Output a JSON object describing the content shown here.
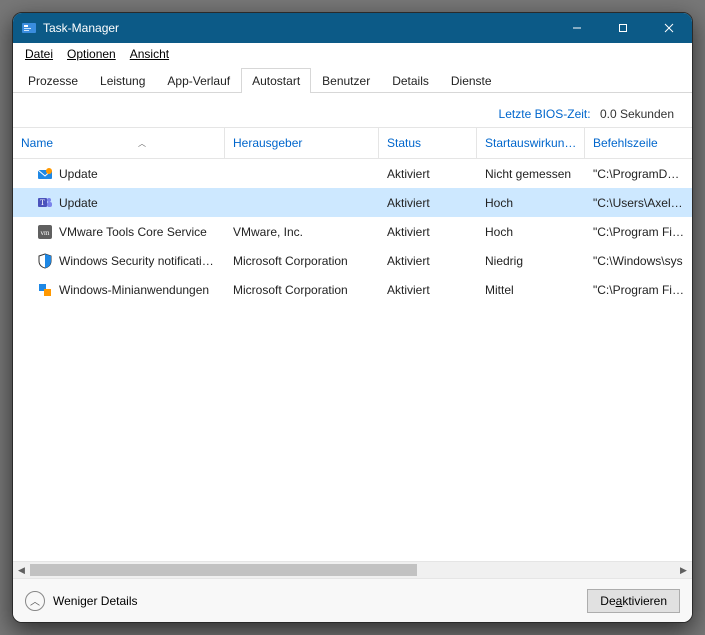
{
  "window": {
    "title": "Task-Manager"
  },
  "menu": {
    "items": [
      "Datei",
      "Optionen",
      "Ansicht"
    ]
  },
  "tabs": {
    "items": [
      "Prozesse",
      "Leistung",
      "App-Verlauf",
      "Autostart",
      "Benutzer",
      "Details",
      "Dienste"
    ],
    "active_index": 3
  },
  "bios": {
    "label": "Letzte BIOS-Zeit:",
    "value": "0.0 Sekunden"
  },
  "columns": {
    "name": "Name",
    "publisher": "Herausgeber",
    "status": "Status",
    "impact": "Startauswirkun…",
    "cmdline": "Befehlszeile"
  },
  "rows": [
    {
      "icon": "update-envelope-icon",
      "name": "Update",
      "publisher": "",
      "status": "Aktiviert",
      "impact": "Nicht gemessen",
      "cmdline": "\"C:\\ProgramData\\",
      "selected": false
    },
    {
      "icon": "teams-icon",
      "name": "Update",
      "publisher": "",
      "status": "Aktiviert",
      "impact": "Hoch",
      "cmdline": "\"C:\\Users\\Axel\\Ap",
      "selected": true
    },
    {
      "icon": "vmware-icon",
      "name": "VMware Tools Core Service",
      "publisher": "VMware, Inc.",
      "status": "Aktiviert",
      "impact": "Hoch",
      "cmdline": "\"C:\\Program Files",
      "selected": false
    },
    {
      "icon": "shield-icon",
      "name": "Windows Security notificati…",
      "publisher": "Microsoft Corporation",
      "status": "Aktiviert",
      "impact": "Niedrig",
      "cmdline": "\"C:\\Windows\\sys",
      "selected": false
    },
    {
      "icon": "gadgets-icon",
      "name": "Windows-Minianwendungen",
      "publisher": "Microsoft Corporation",
      "status": "Aktiviert",
      "impact": "Mittel",
      "cmdline": "\"C:\\Program Files",
      "selected": false
    }
  ],
  "footer": {
    "fewer_details": "Weniger Details",
    "action_button": "Deaktivieren"
  }
}
